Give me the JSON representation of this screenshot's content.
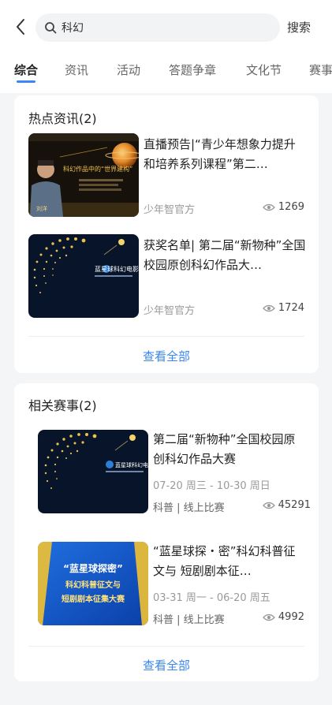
{
  "search": {
    "value": "科幻",
    "button_label": "搜索"
  },
  "tabs": [
    {
      "label": "综合",
      "active": true
    },
    {
      "label": "资讯",
      "active": false
    },
    {
      "label": "活动",
      "active": false
    },
    {
      "label": "答题争章",
      "active": false
    },
    {
      "label": "文化节",
      "active": false
    },
    {
      "label": "赛事",
      "active": false
    }
  ],
  "hot_news": {
    "title": "热点资讯(2)",
    "items": [
      {
        "title": "直播预告|“青少年想象力提升和培养系列课程”第二…",
        "source": "少年智官方",
        "views": "1269"
      },
      {
        "title": "获奖名单| 第二届“新物种”全国校园原创科幻作品大…",
        "source": "少年智官方",
        "views": "1724"
      }
    ],
    "view_all": "查看全部"
  },
  "events": {
    "title": "相关赛事(2)",
    "items": [
      {
        "title": "第二届“新物种”全国校园原创科幻作品大赛",
        "date": "07-20 周三 - 10-30 周日",
        "tags": "科普 | 线上比赛",
        "views": "45291"
      },
      {
        "title": "“蓝星球探・密”科幻科普征文与 短剧剧本征…",
        "date": "03-31 周一 - 06-20 周五",
        "tags": "科普 | 线上比赛",
        "views": "4992"
      }
    ],
    "view_all": "查看全部"
  },
  "thumb_text": {
    "lecture_caption": "科幻作品中的“世界建构”",
    "speaker": "刘洋",
    "brand": "蓝星球科幻电影",
    "poster_line1": "“蓝星球探密”",
    "poster_line2": "科幻科普征文与",
    "poster_line3": "短剧剧本征集大赛"
  },
  "colors": {
    "accent": "#3a86f5",
    "background": "#f3f5f7"
  }
}
